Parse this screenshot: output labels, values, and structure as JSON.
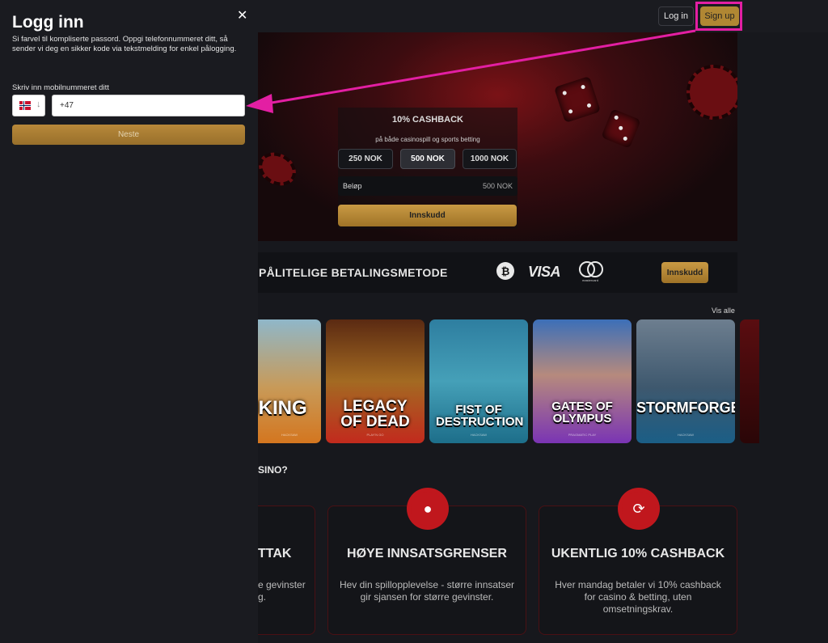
{
  "login_panel": {
    "title": "Logg inn",
    "close_icon": "close-icon",
    "description": "Si farvel til kompliserte passord. Oppgi telefonnummeret ditt, så sender vi deg en sikker kode via tekstmelding for enkel pålogging.",
    "phone_label": "Skriv inn mobilnummeret ditt",
    "country_flag": "norway-flag-icon",
    "country_arrow": "↓",
    "phone_value": "+47",
    "next_label": "Neste"
  },
  "header": {
    "login_label": "Log in",
    "signup_label": "Sign up"
  },
  "hero": {
    "cashback_title": "10% CASHBACK",
    "cashback_sub": "på både casinospill og sports betting",
    "amounts": [
      "250 NOK",
      "500 NOK",
      "1000 NOK"
    ],
    "selected_amount": "500 NOK",
    "amount_label": "Beløp",
    "amount_value": "500 NOK",
    "deposit_label": "Innskudd"
  },
  "payments": {
    "title": "PÅLITELIGE BETALINGSMETODE",
    "bitcoin_symbol": "₿",
    "visa": "VISA",
    "mastercard": "mastercard",
    "deposit_label": "Innskudd"
  },
  "games": {
    "view_all": "Vis alle",
    "items": [
      {
        "title": "VIKING",
        "provider": "HACKSAW"
      },
      {
        "title": "LEGACY OF DEAD",
        "provider": "PLAY'N GO"
      },
      {
        "title": "FIST OF DESTRUCTION",
        "provider": "HACKSAW"
      },
      {
        "title": "GATES OF OLYMPUS",
        "provider": "PRAGMATIC PLAY"
      },
      {
        "title": "STORMFORGED",
        "provider": "HACKSAW"
      }
    ]
  },
  "features": {
    "heading_fragment": "SINO?",
    "items": [
      {
        "title": "TTAK",
        "text": "e gevinster\ng."
      },
      {
        "title": "HØYE INNSATSGRENSER",
        "text": "Hev din spillopplevelse - større innsatser gir sjansen for større gevinster."
      },
      {
        "title": "UKENTLIG 10% CASHBACK",
        "text": "Hver mandag betaler vi 10% cashback for casino & betting, uten omsetningskrav."
      }
    ]
  },
  "colors": {
    "accent_gold": "#b08733",
    "annotation_magenta": "#e31fa3",
    "brand_red": "#c0171d"
  }
}
